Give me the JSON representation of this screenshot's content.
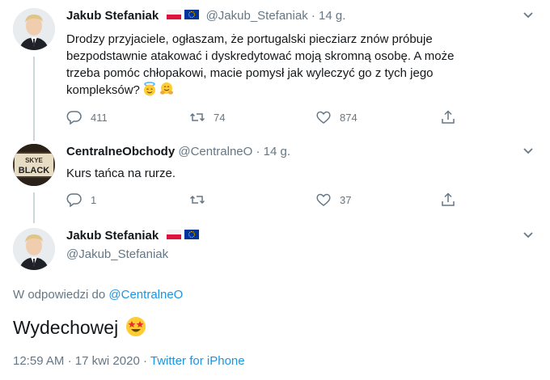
{
  "tweet1": {
    "name": "Jakub Stefaniak",
    "handle": "@Jakub_Stefaniak",
    "dot": "·",
    "time": "14 g.",
    "text_lines": [
      "Drodzy przyjaciele, ogłaszam, że portugalski piecziarz znów próbuje",
      "bezpodstawnie atakować i dyskredytować moją skromną osobę. A może",
      "trzeba pomóc chłopakowi, macie pomysł jak wyleczyć go z tych jego",
      "kompleksów?"
    ],
    "emojis": [
      "smiling-face-with-halo-icon",
      "hugging-face-icon"
    ],
    "replies": "411",
    "retweets": "74",
    "likes": "874"
  },
  "tweet2": {
    "name": "CentralneObchody",
    "handle": "@CentralneO",
    "dot": "·",
    "time": "14 g.",
    "avatar_text": "SKYE BLACK",
    "text": "Kurs tańca na rurze.",
    "replies": "1",
    "retweets": "",
    "likes": "37"
  },
  "main": {
    "name": "Jakub Stefaniak",
    "handle": "@Jakub_Stefaniak",
    "reply_prefix": "W odpowiedzi do",
    "reply_handle": "@CentralneO",
    "text": "Wydechowej",
    "emoji": "star-struck-icon",
    "timestamp": "12:59 AM",
    "date": "17 kwi 2020",
    "sep": "·",
    "source": "Twitter for iPhone"
  },
  "colors": {
    "text": "#14171a",
    "muted": "#657786",
    "link": "#1b95e0",
    "thread_line": "#ccd6dd"
  }
}
